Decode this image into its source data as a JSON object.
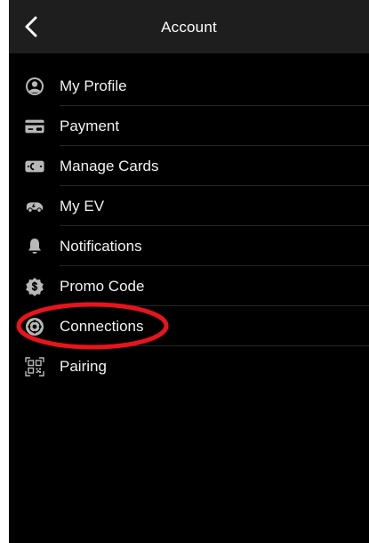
{
  "header": {
    "title": "Account",
    "back_icon": "chevron-left-icon"
  },
  "menu": {
    "items": [
      {
        "label": "My Profile",
        "icon": "user-circle-icon"
      },
      {
        "label": "Payment",
        "icon": "credit-card-icon"
      },
      {
        "label": "Manage Cards",
        "icon": "charge-card-icon"
      },
      {
        "label": "My EV",
        "icon": "ev-car-icon"
      },
      {
        "label": "Notifications",
        "icon": "bell-icon"
      },
      {
        "label": "Promo Code",
        "icon": "promo-badge-icon"
      },
      {
        "label": "Connections",
        "icon": "connections-icon"
      },
      {
        "label": "Pairing",
        "icon": "qr-code-icon"
      }
    ]
  },
  "annotation": {
    "highlighted_item": "Connections",
    "color": "#e8141c"
  },
  "colors": {
    "background": "#000000",
    "header": "#1e1e1e",
    "text": "#f2f2f2",
    "icon": "#b8b8b8",
    "divider": "#262626"
  }
}
